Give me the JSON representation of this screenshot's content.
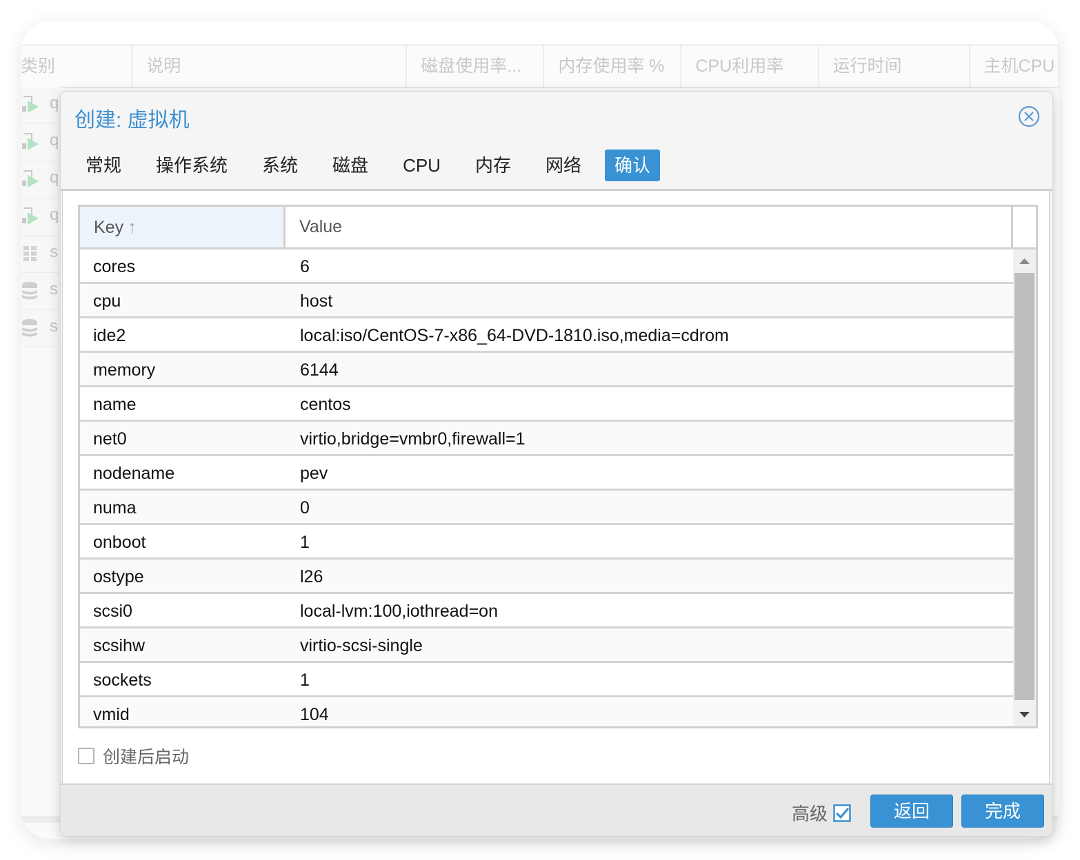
{
  "background": {
    "columns": [
      "类别",
      "说明",
      "磁盘使用率...",
      "内存使用率 %",
      "CPU利用率",
      "运行时间",
      "主机CPU"
    ],
    "rows": [
      {
        "icon": "vm-running-icon",
        "text": "q"
      },
      {
        "icon": "vm-running-icon",
        "text": "q"
      },
      {
        "icon": "vm-running-icon",
        "text": "q"
      },
      {
        "icon": "vm-running-icon",
        "text": "q"
      },
      {
        "icon": "grid-icon",
        "text": "s"
      },
      {
        "icon": "storage-icon",
        "text": "s"
      },
      {
        "icon": "storage-icon",
        "text": "s"
      }
    ]
  },
  "dialog": {
    "title": "创建: 虚拟机",
    "tabs": [
      {
        "label": "常规",
        "active": false
      },
      {
        "label": "操作系统",
        "active": false
      },
      {
        "label": "系统",
        "active": false
      },
      {
        "label": "磁盘",
        "active": false
      },
      {
        "label": "CPU",
        "active": false
      },
      {
        "label": "内存",
        "active": false
      },
      {
        "label": "网络",
        "active": false
      },
      {
        "label": "确认",
        "active": true
      }
    ],
    "grid": {
      "headers": {
        "key": "Key",
        "key_sort": "↑",
        "value": "Value"
      },
      "rows": [
        {
          "key": "cores",
          "value": "6"
        },
        {
          "key": "cpu",
          "value": "host"
        },
        {
          "key": "ide2",
          "value": "local:iso/CentOS-7-x86_64-DVD-1810.iso,media=cdrom"
        },
        {
          "key": "memory",
          "value": "6144"
        },
        {
          "key": "name",
          "value": "centos"
        },
        {
          "key": "net0",
          "value": "virtio,bridge=vmbr0,firewall=1"
        },
        {
          "key": "nodename",
          "value": "pev"
        },
        {
          "key": "numa",
          "value": "0"
        },
        {
          "key": "onboot",
          "value": "1"
        },
        {
          "key": "ostype",
          "value": "l26"
        },
        {
          "key": "scsi0",
          "value": "local-lvm:100,iothread=on"
        },
        {
          "key": "scsihw",
          "value": "virtio-scsi-single"
        },
        {
          "key": "sockets",
          "value": "1"
        },
        {
          "key": "vmid",
          "value": "104"
        }
      ]
    },
    "start_after_create": {
      "label": "创建后启动",
      "checked": false
    },
    "advanced": {
      "label": "高级",
      "checked": true
    },
    "buttons": {
      "back": "返回",
      "finish": "完成"
    }
  },
  "colors": {
    "accent": "#3892d3",
    "title": "#3a8fd0"
  }
}
